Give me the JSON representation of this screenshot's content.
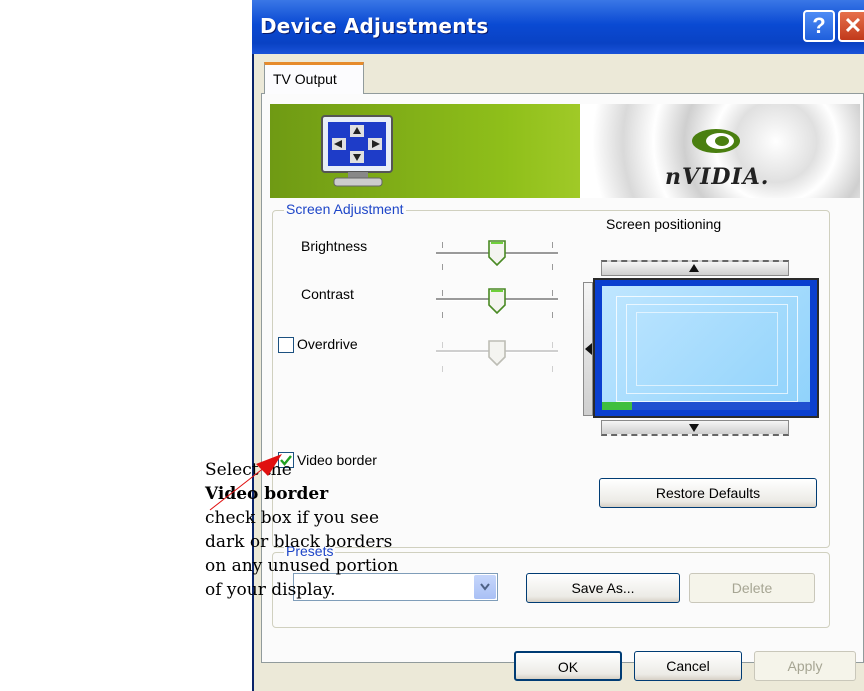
{
  "window": {
    "title": "Device Adjustments",
    "help_label": "?",
    "close_label": "✕"
  },
  "tab": {
    "label": "TV Output"
  },
  "banner": {
    "brand": "nVIDIA."
  },
  "screen_adjustment": {
    "group_label": "Screen Adjustment",
    "brightness_label": "Brightness",
    "contrast_label": "Contrast",
    "overdrive_label": "Overdrive",
    "overdrive_checked": false,
    "brightness_level": 0.5,
    "contrast_level": 0.5,
    "overdrive_level": 0.5
  },
  "screen_positioning": {
    "label": "Screen positioning"
  },
  "video_border": {
    "label": "Video border",
    "checked": true
  },
  "restore_defaults_label": "Restore Defaults",
  "presets": {
    "group_label": "Presets",
    "selected": "",
    "save_as_label": "Save As...",
    "delete_label": "Delete"
  },
  "footer": {
    "ok_label": "OK",
    "cancel_label": "Cancel",
    "apply_label": "Apply"
  },
  "annotation": {
    "line1": "Select the",
    "line2": "Video border",
    "line3": "check box if you see",
    "line4": "dark or black borders",
    "line5": "on any unused portion",
    "line6": "of your display."
  },
  "colors": {
    "titlebar": "#0a4ad3",
    "group_label": "#1e46c8",
    "arrow": "#e01010",
    "banner_green": "#8fbf1a"
  }
}
